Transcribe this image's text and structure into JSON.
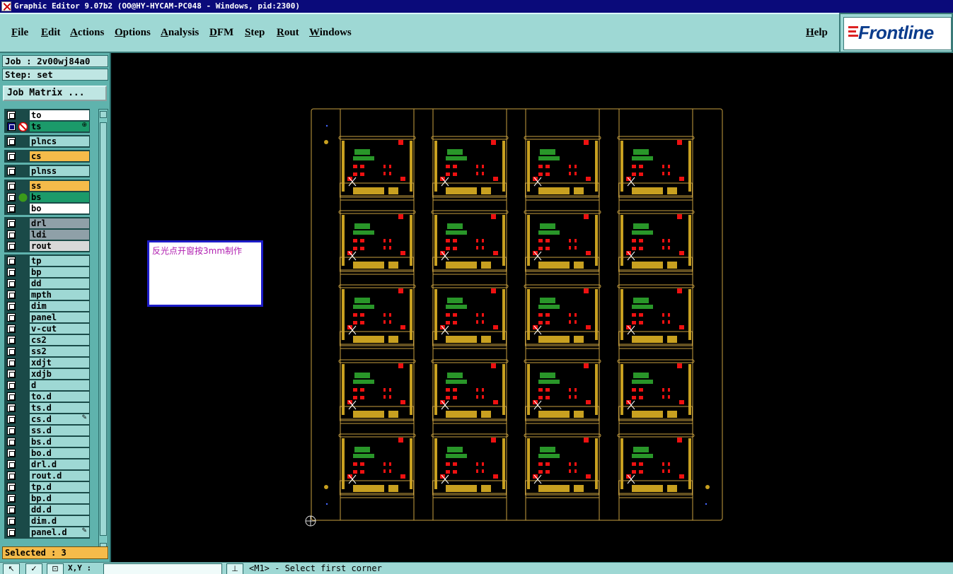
{
  "title": "Graphic Editor 9.07b2 (OO@HY-HYCAM-PC048 - Windows, pid:2300)",
  "menu": [
    "File",
    "Edit",
    "Actions",
    "Options",
    "Analysis",
    "DFM",
    "Step",
    "Rout",
    "Windows"
  ],
  "help": "Help",
  "logo": "Frontline",
  "job": "Job : 2v00wj84a0",
  "step": "Step: set",
  "job_matrix": "Job Matrix ...",
  "layer_groups": [
    [
      {
        "name": "to",
        "style": "white"
      },
      {
        "name": "ts",
        "style": "green",
        "active": true,
        "mark": "⊕"
      }
    ],
    [
      {
        "name": "plncs",
        "style": "normal"
      }
    ],
    [
      {
        "name": "cs",
        "style": "yellow"
      }
    ],
    [
      {
        "name": "plnss",
        "style": "normal"
      }
    ],
    [
      {
        "name": "ss",
        "style": "yellow"
      },
      {
        "name": "bs",
        "style": "green",
        "dot": true
      },
      {
        "name": "bo",
        "style": "white"
      }
    ],
    [
      {
        "name": "drl",
        "style": "gray"
      },
      {
        "name": "ldi",
        "style": "gray"
      },
      {
        "name": "rout",
        "style": "light"
      }
    ],
    [
      {
        "name": "tp"
      },
      {
        "name": "bp"
      },
      {
        "name": "dd"
      },
      {
        "name": "mpth"
      },
      {
        "name": "dim"
      },
      {
        "name": "panel"
      },
      {
        "name": "v-cut"
      },
      {
        "name": "cs2"
      },
      {
        "name": "ss2"
      },
      {
        "name": "xdjt"
      },
      {
        "name": "xdjb"
      },
      {
        "name": "d"
      },
      {
        "name": "to.d"
      },
      {
        "name": "ts.d"
      },
      {
        "name": "cs.d",
        "mark": "✎"
      },
      {
        "name": "ss.d"
      },
      {
        "name": "bs.d"
      },
      {
        "name": "bo.d"
      },
      {
        "name": "drl.d"
      },
      {
        "name": "rout.d"
      },
      {
        "name": "tp.d"
      },
      {
        "name": "bp.d"
      },
      {
        "name": "dd.d"
      },
      {
        "name": "dim.d"
      },
      {
        "name": "panel.d",
        "mark": "✎"
      }
    ]
  ],
  "selected": "Selected : 3",
  "note": "反光点开窗按3mm制作",
  "bottom": {
    "xy_label": "X,Y :",
    "status": "<M1> - Select first corner"
  },
  "colors": {
    "outline": "#c8a040",
    "pad_red": "#ee1111",
    "silk_green": "#33bb33",
    "gold": "#c8a020"
  },
  "panel": {
    "columns": 4,
    "rows": 5
  }
}
